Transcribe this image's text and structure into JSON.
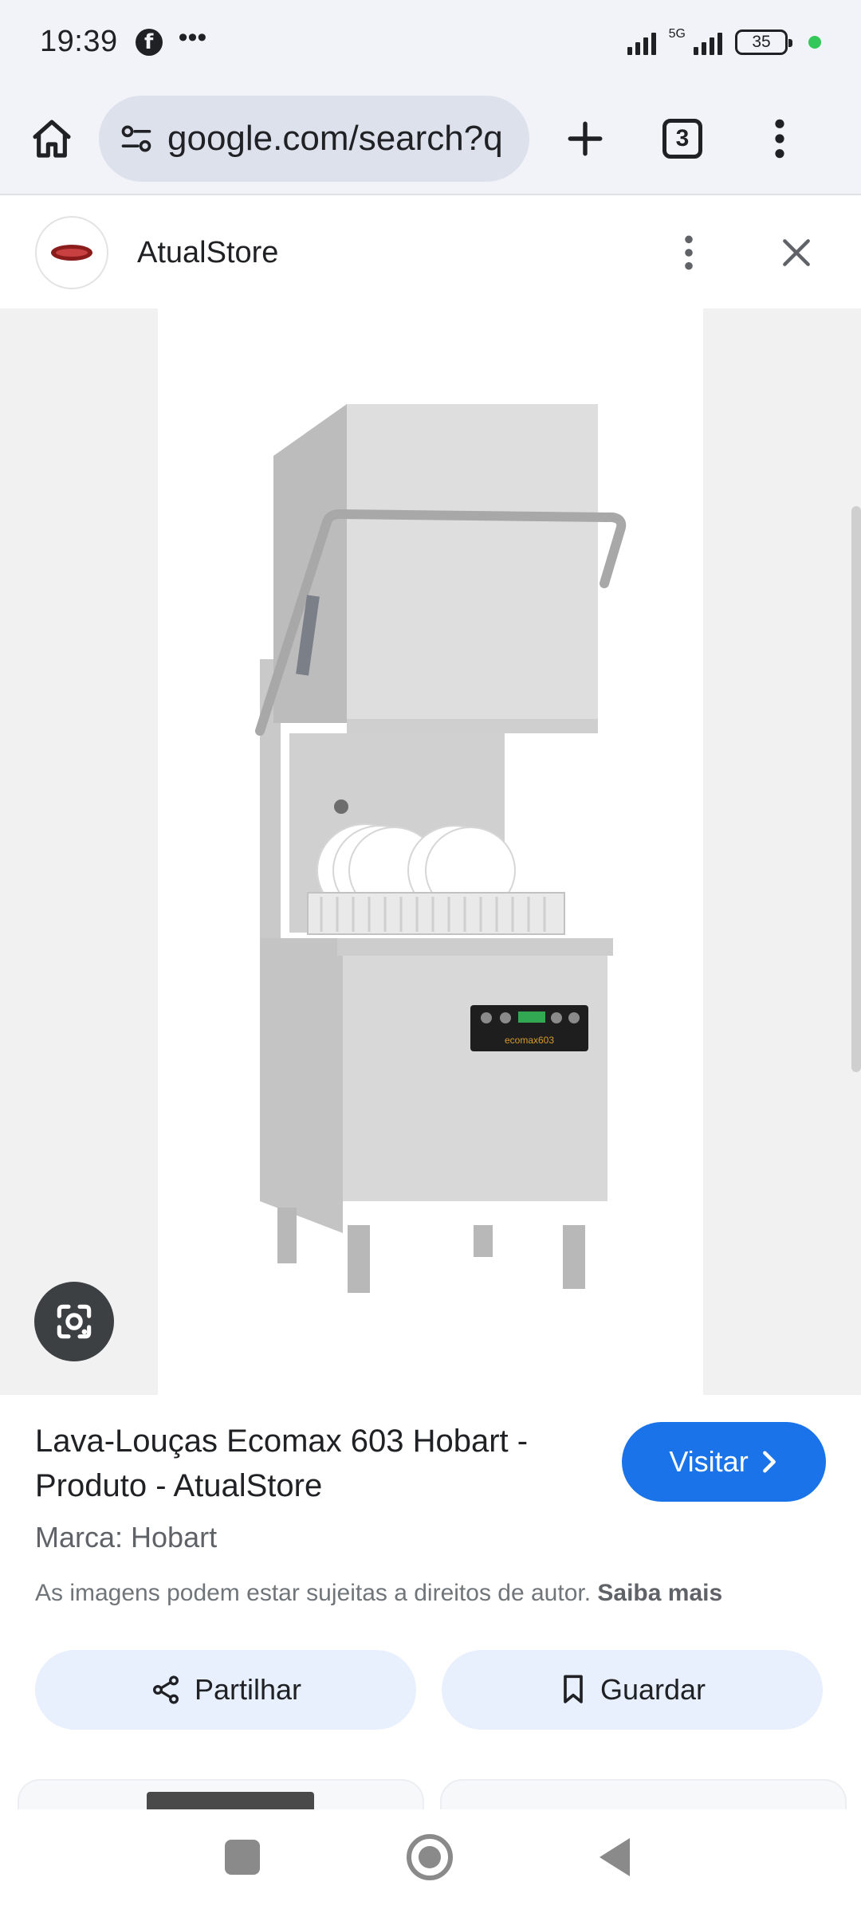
{
  "status_bar": {
    "time": "19:39",
    "network_label": "5G",
    "battery_level": "35",
    "icons": [
      "facebook-icon",
      "more-dots-icon",
      "signal-icon",
      "battery-icon"
    ]
  },
  "toolbar": {
    "url": "google.com/search?q",
    "tab_count": "3",
    "icons": [
      "home-icon",
      "site-settings-icon",
      "plus-icon",
      "tabs-icon",
      "menu-dots-icon"
    ]
  },
  "source": {
    "name": "AtualStore",
    "icons": [
      "more-vert-icon",
      "close-icon"
    ]
  },
  "image": {
    "subject": "dishwasher",
    "display_text": "ecomax603",
    "lens_icon": "google-lens-icon"
  },
  "info": {
    "product_title": "Lava-Louças Ecomax 603 Hobart - Produto - AtualStore",
    "visit_label": "Visitar",
    "brand_line": "Marca: Hobart",
    "copyright_text": "As imagens podem estar sujeitas a direitos de autor.",
    "learn_more": "Saiba mais",
    "share_label": "Partilhar",
    "save_label": "Guardar"
  },
  "colors": {
    "accent": "#1a73e8",
    "chip_bg": "#e8f0fe",
    "toolbar_bg": "#f1f3f8",
    "omnibox_bg": "#dde1ec"
  },
  "nav": {
    "icons": [
      "recent-apps-icon",
      "home-nav-icon",
      "back-icon"
    ]
  }
}
